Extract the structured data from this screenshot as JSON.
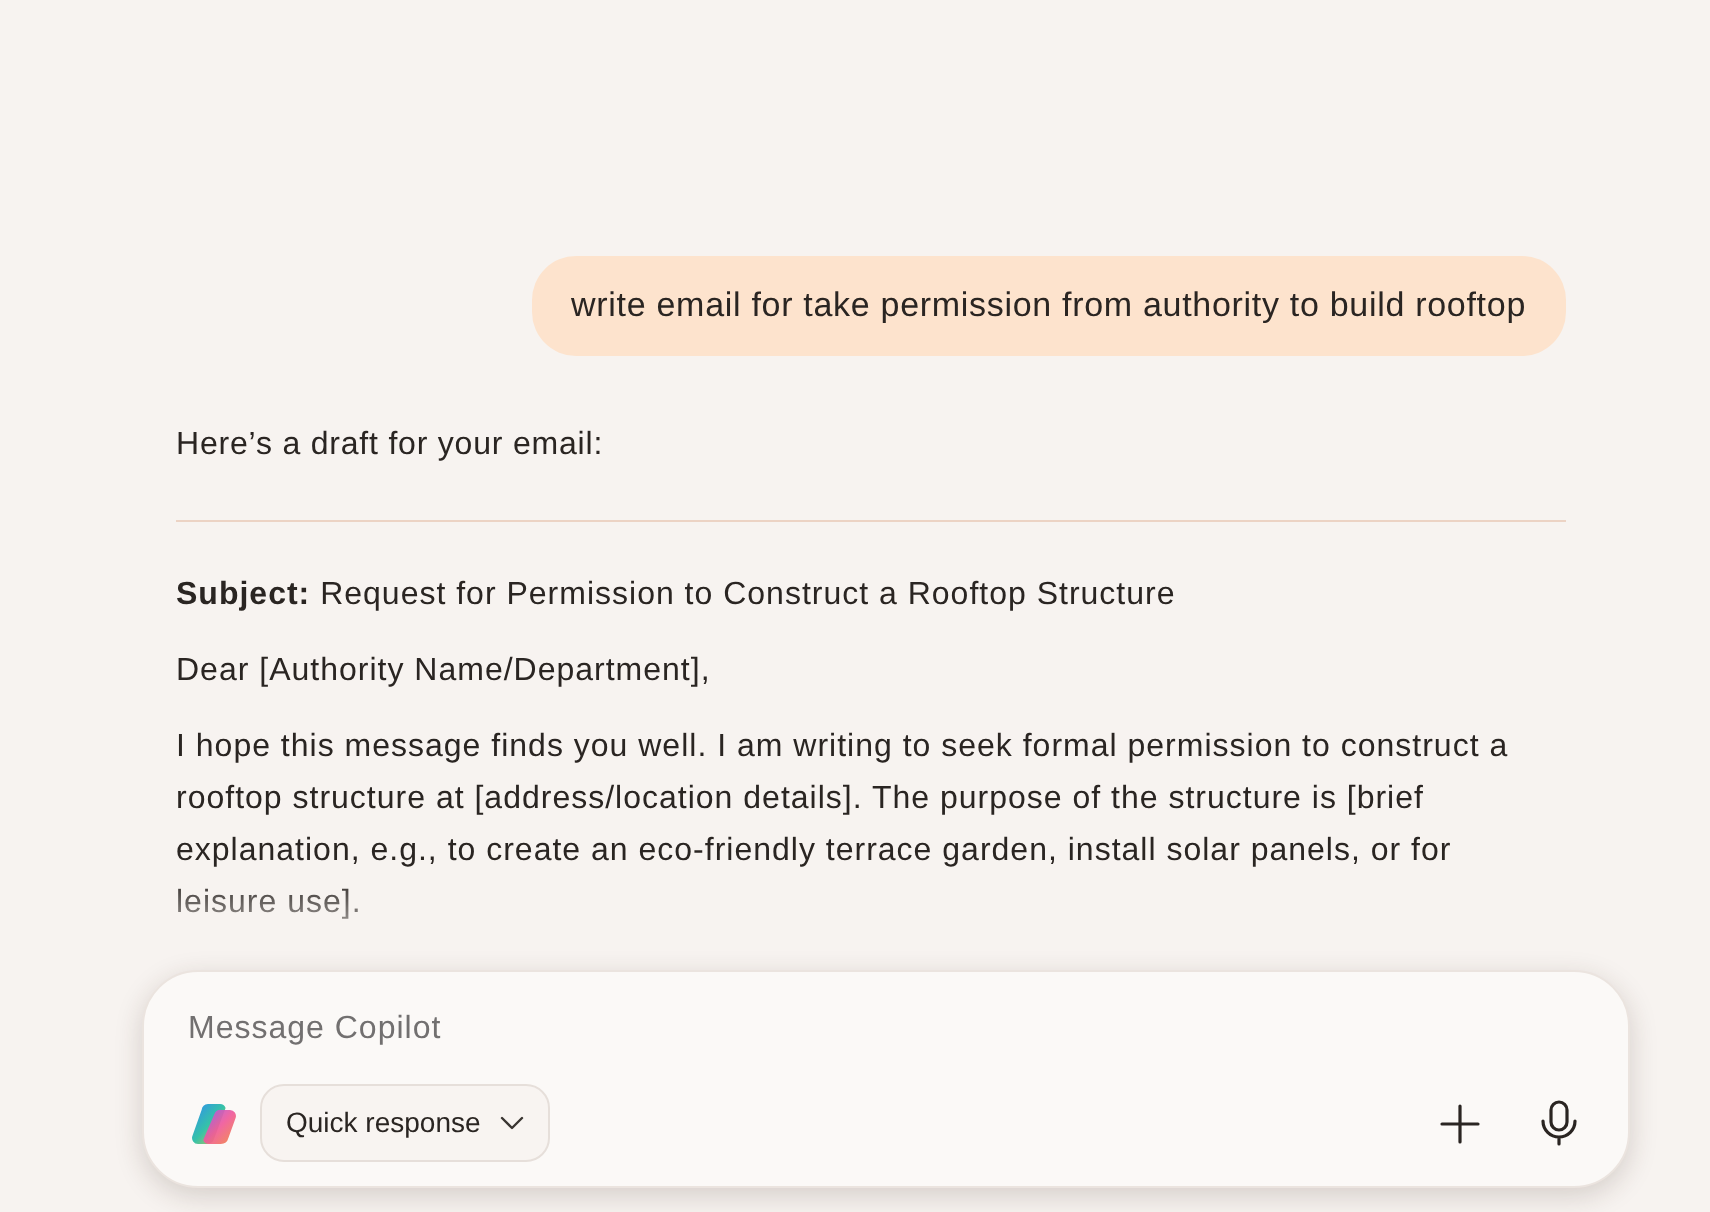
{
  "conversation": {
    "messages": [
      {
        "kind": "user",
        "text": "write email for take permission from authority to build rooftop"
      },
      {
        "kind": "assistant",
        "intro": "Here’s a draft for your email:",
        "blocks": [
          {
            "kind": "divider"
          },
          {
            "kind": "paragraph",
            "text": "**Subject:** Request for Permission to Construct a Rooftop Structure"
          },
          {
            "kind": "paragraph",
            "text": "Dear [Authority Name/Department],"
          },
          {
            "kind": "paragraph",
            "text": "I hope this message finds you well. I am writing to seek formal permission to construct a rooftop structure at [address/location details]. The purpose of the structure is [brief explanation, e.g., to create an eco-friendly terrace garden, install solar panels, or for leisure use]."
          }
        ]
      }
    ]
  },
  "composer": {
    "placeholder": "Message Copilot",
    "mode_button": {
      "label": "Quick response"
    }
  }
}
